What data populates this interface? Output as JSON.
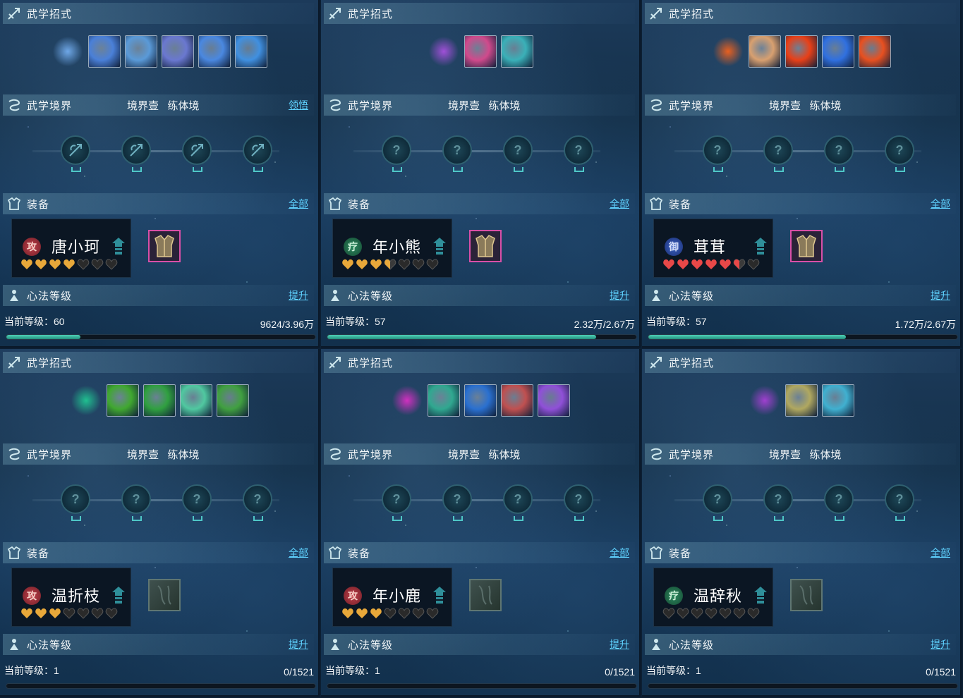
{
  "labels": {
    "moves_title": "武学招式",
    "realm_title": "武学境界",
    "realm_tier": "境界壹",
    "realm_stage": "练体境",
    "equip_title": "装备",
    "equip_all": "全部",
    "heart_title": "心法等级",
    "heart_up": "提升",
    "level_prefix": "当前等级："
  },
  "panels": [
    {
      "name": "唐小珂",
      "role": "atk",
      "role_glyph": "攻",
      "level": "60",
      "exp": "9624/3.96万",
      "progress": 0.24,
      "realm_link": "领悟",
      "hearts": {
        "type": "gold",
        "full": 4,
        "half": 0,
        "total": 7
      },
      "gear": "has",
      "moves": [
        "#6fa8e8",
        "#4a80d8",
        "#5a9ad8",
        "#6a78d0",
        "#4a88e0",
        "#4090e0"
      ],
      "realm_nodes": [
        "bow",
        "arrow",
        "shield",
        "target"
      ]
    },
    {
      "name": "年小熊",
      "role": "heal",
      "role_glyph": "疗",
      "level": "57",
      "exp": "2.32万/2.67万",
      "progress": 0.87,
      "realm_link": "",
      "hearts": {
        "type": "gold",
        "full": 3,
        "half": 1,
        "total": 7
      },
      "gear": "has",
      "moves": [
        "#a050d8",
        "#d04a8c",
        "#3ab0b8"
      ],
      "realm_nodes": [
        "?",
        "?",
        "?",
        "?"
      ]
    },
    {
      "name": "茸茸",
      "role": "def",
      "role_glyph": "御",
      "level": "57",
      "exp": "1.72万/2.67万",
      "progress": 0.64,
      "realm_link": "",
      "hearts": {
        "type": "red",
        "full": 5,
        "half": 1,
        "total": 7
      },
      "gear": "has",
      "moves": [
        "#e86020",
        "#d8a070",
        "#e84018",
        "#3070e0",
        "#e85020"
      ],
      "realm_nodes": [
        "?",
        "?",
        "?",
        "?"
      ]
    },
    {
      "name": "温折枝",
      "role": "atk",
      "role_glyph": "攻",
      "level": "1",
      "exp": "0/1521",
      "progress": 0,
      "realm_link": "",
      "hearts": {
        "type": "gold",
        "full": 3,
        "half": 0,
        "total": 7
      },
      "gear": "empty",
      "moves": [
        "#20c090",
        "#40a830",
        "#30a040",
        "#50c8a0",
        "#40a040"
      ],
      "realm_nodes": [
        "?",
        "?",
        "?",
        "?"
      ]
    },
    {
      "name": "年小鹿",
      "role": "atk",
      "role_glyph": "攻",
      "level": "1",
      "exp": "0/1521",
      "progress": 0,
      "realm_link": "",
      "hearts": {
        "type": "gold",
        "full": 3,
        "half": 0,
        "total": 7
      },
      "gear": "empty",
      "moves": [
        "#d030c0",
        "#30a890",
        "#2a70d0",
        "#c05050",
        "#9050d8"
      ],
      "realm_nodes": [
        "?",
        "?",
        "?",
        "?"
      ]
    },
    {
      "name": "温辞秋",
      "role": "heal",
      "role_glyph": "疗",
      "level": "1",
      "exp": "0/1521",
      "progress": 0,
      "realm_link": "",
      "hearts": {
        "type": "gold",
        "full": 0,
        "half": 0,
        "total": 7
      },
      "gear": "empty",
      "moves": [
        "#a040d0",
        "#b0a860",
        "#40b0d0"
      ],
      "realm_nodes": [
        "?",
        "?",
        "?",
        "?"
      ]
    }
  ],
  "colors": {
    "accent": "#5fd2ff",
    "progress": "#3fbfa8",
    "gold_heart": "#e8a83a",
    "red_heart": "#e84848",
    "empty_heart": "#3a3a3a"
  }
}
